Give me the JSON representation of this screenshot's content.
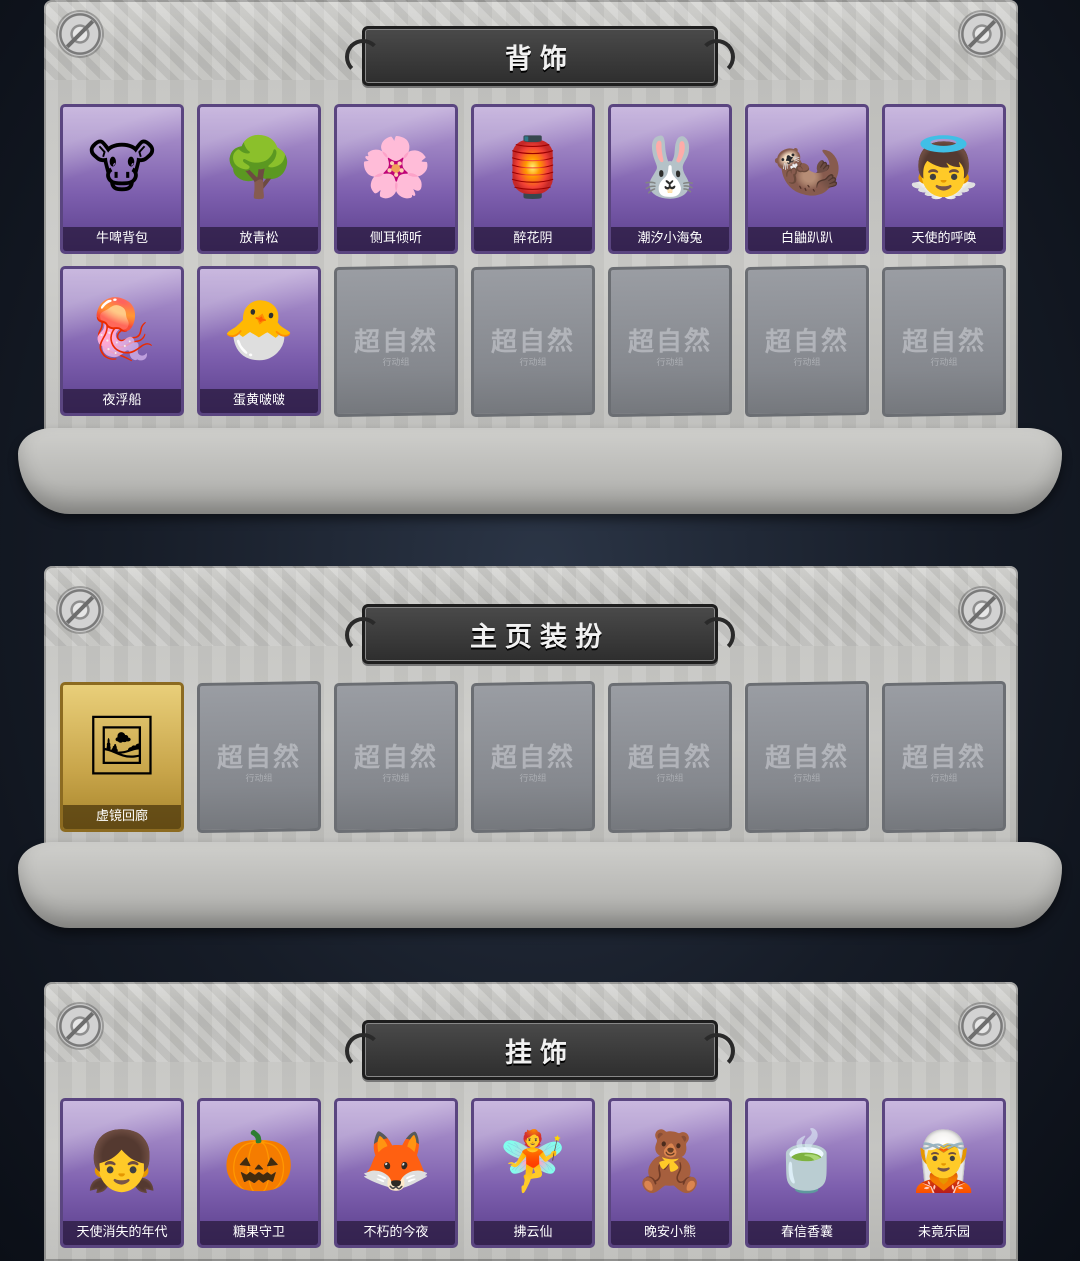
{
  "sections": [
    {
      "title": "背饰",
      "items": [
        {
          "label": "牛啤背包",
          "icon": "🐮",
          "type": "purple"
        },
        {
          "label": "放青松",
          "icon": "🌳",
          "type": "purple"
        },
        {
          "label": "侧耳倾听",
          "icon": "🌸",
          "type": "purple"
        },
        {
          "label": "醉花阴",
          "icon": "🏮",
          "type": "purple"
        },
        {
          "label": "潮汐小海兔",
          "icon": "🐰",
          "type": "purple"
        },
        {
          "label": "白鼬趴趴",
          "icon": "🦦",
          "type": "purple"
        },
        {
          "label": "天使的呼唤",
          "icon": "👼",
          "type": "purple"
        },
        {
          "label": "夜浮船",
          "icon": "🪼",
          "type": "purple"
        },
        {
          "label": "蛋黄啵啵",
          "icon": "🐣",
          "type": "purple"
        },
        {
          "label": "",
          "type": "empty"
        },
        {
          "label": "",
          "type": "empty"
        },
        {
          "label": "",
          "type": "empty"
        },
        {
          "label": "",
          "type": "empty"
        },
        {
          "label": "",
          "type": "empty"
        }
      ]
    },
    {
      "title": "主页装扮",
      "items": [
        {
          "label": "虚镜回廊",
          "icon": "🖼",
          "type": "gold"
        },
        {
          "label": "",
          "type": "empty"
        },
        {
          "label": "",
          "type": "empty"
        },
        {
          "label": "",
          "type": "empty"
        },
        {
          "label": "",
          "type": "empty"
        },
        {
          "label": "",
          "type": "empty"
        },
        {
          "label": "",
          "type": "empty"
        }
      ]
    },
    {
      "title": "挂饰",
      "items": [
        {
          "label": "天使消失的年代",
          "icon": "👧",
          "type": "purple"
        },
        {
          "label": "糖果守卫",
          "icon": "🎃",
          "type": "purple"
        },
        {
          "label": "不朽的今夜",
          "icon": "🦊",
          "type": "purple"
        },
        {
          "label": "拂云仙",
          "icon": "🧚",
          "type": "purple"
        },
        {
          "label": "晚安小熊",
          "icon": "🧸",
          "type": "purple"
        },
        {
          "label": "春信香囊",
          "icon": "🍵",
          "type": "purple"
        },
        {
          "label": "未竟乐园",
          "icon": "🧝",
          "type": "purple"
        }
      ]
    }
  ],
  "placeholder_logo": "超自然",
  "placeholder_sub": "行动组"
}
